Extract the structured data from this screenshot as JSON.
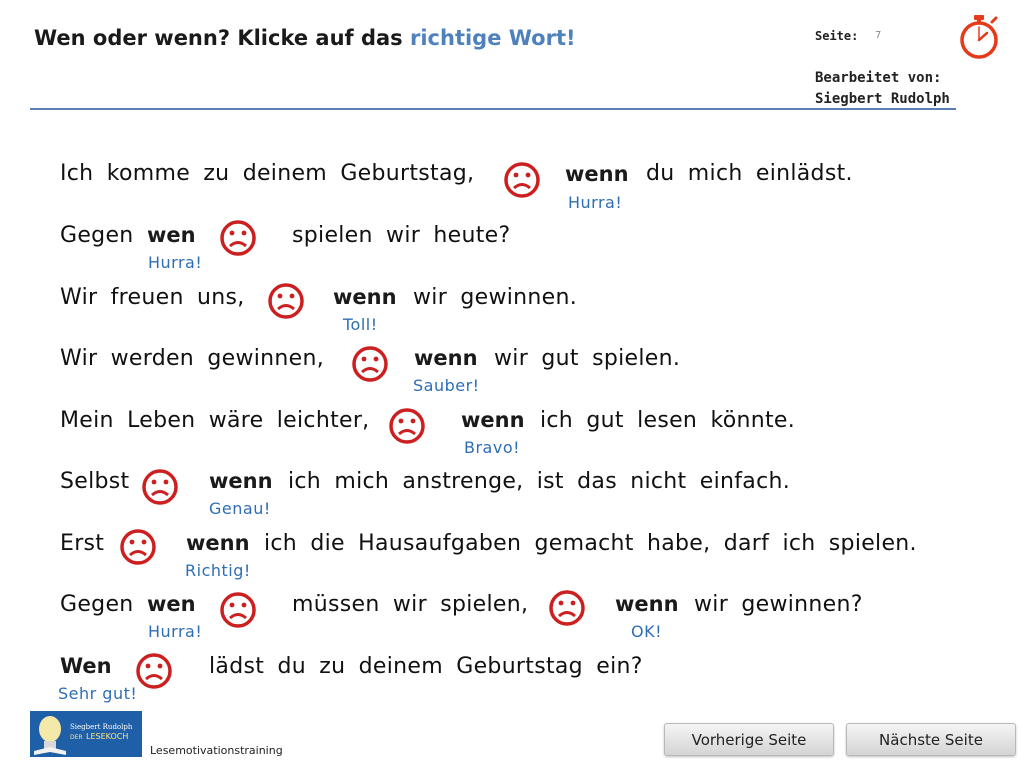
{
  "header": {
    "title_main": "Wen oder wenn? Klicke auf das",
    "title_accent": "richtige Wort!",
    "page_label": "Seite:",
    "page_number": "7",
    "editor_label": "Bearbeitet von:",
    "editor_name": "Siegbert Rudolph"
  },
  "sentences": [
    {
      "part1": "Ich komme zu deinem Geburtstag,",
      "word": "wenn",
      "feedback": "Hurra!",
      "part2": "du mich einlädst."
    },
    {
      "part1": "Gegen",
      "word": "wen",
      "feedback": "Hurra!",
      "part2": "spielen wir heute?"
    },
    {
      "part1": "Wir freuen uns,",
      "word": "wenn",
      "feedback": "Toll!",
      "part2": "wir gewinnen."
    },
    {
      "part1": "Wir werden gewinnen,",
      "word": "wenn",
      "feedback": "Sauber!",
      "part2": "wir gut spielen."
    },
    {
      "part1": "Mein Leben wäre leichter,",
      "word": "wenn",
      "feedback": "Bravo!",
      "part2": "ich gut lesen könnte."
    },
    {
      "part1": "Selbst",
      "word": "wenn",
      "feedback": "Genau!",
      "part2": "ich mich anstrenge, ist das nicht einfach."
    },
    {
      "part1": "Erst",
      "word": "wenn",
      "feedback": "Richtig!",
      "part2": "ich die Hausaufgaben gemacht habe, darf ich spielen."
    },
    {
      "part1": "Gegen",
      "word": "wen",
      "feedback": "Hurra!",
      "part2": "müssen wir spielen,",
      "word2": "wenn",
      "feedback2": "OK!",
      "part3": "wir gewinnen?"
    },
    {
      "word": "Wen",
      "feedback": "Sehr gut!",
      "part2": "lädst du zu deinem Geburtstag ein?"
    }
  ],
  "footer": {
    "logo_author": "Siegbert Rudolph",
    "logo_brand_prefix": "DER",
    "logo_brand": "LESEKOCH",
    "label": "Lesemotivationstraining",
    "prev_button": "Vorherige Seite",
    "next_button": "Nächste Seite"
  },
  "icons": {
    "timer": "stopwatch-icon",
    "wrong": "sad-face-icon",
    "logo": "lightbulb-book-logo"
  },
  "colors": {
    "accent": "#4f81bd",
    "feedback": "#2e6eb5",
    "sad_face": "#cc1f1f",
    "stopwatch": "#e53b1b",
    "header_line": "#5b7fb5"
  }
}
